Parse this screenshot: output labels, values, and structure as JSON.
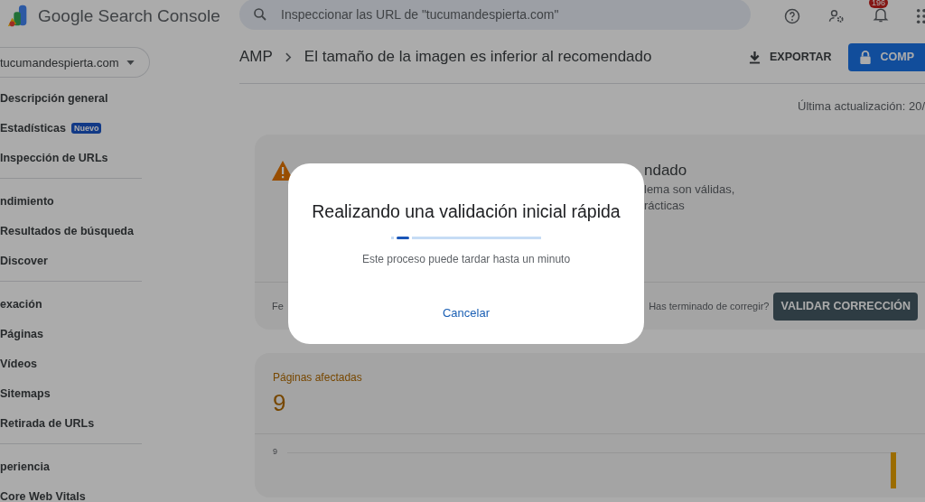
{
  "header": {
    "product": "Google Search Console",
    "search": {
      "placeholder": "Inspeccionar las URL de \"tucumandespierta.com\""
    },
    "notifications_badge": "196"
  },
  "sidebar": {
    "property": "tucumandespierta.com",
    "sections": [
      {
        "items": [
          {
            "label": "Descripción general"
          },
          {
            "label": "Estadísticas",
            "badge": "Nuevo"
          },
          {
            "label": "Inspección de URLs"
          }
        ]
      },
      {
        "heading": "ndimiento",
        "items": [
          {
            "label": "Resultados de búsqueda"
          },
          {
            "label": "Discover"
          }
        ]
      },
      {
        "heading": "exación",
        "items": [
          {
            "label": "Páginas"
          },
          {
            "label": "Vídeos"
          },
          {
            "label": "Sitemaps"
          },
          {
            "label": "Retirada de URLs"
          }
        ]
      },
      {
        "heading": "periencia",
        "items": [
          {
            "label": "Core Web Vitals"
          }
        ]
      }
    ]
  },
  "breadcrumb": [
    "AMP",
    "El tamaño de la imagen es inferior al recomendado"
  ],
  "actions": [
    {
      "label": "EXPORTAR",
      "kind": "export"
    },
    {
      "label": "COMP",
      "kind": "primary"
    }
  ],
  "last_updated": "Última actualización: 20/",
  "issue_card": {
    "title": "ndado",
    "description": [
      "lema son válidas,",
      "rácticas"
    ],
    "footer_left": "Fe",
    "footer_prompt": "Has terminado de corregir?",
    "button": "VALIDAR CORRECCIÓN"
  },
  "affected_card": {
    "label": "Páginas afectadas",
    "value": "9",
    "axis_tick": "9"
  },
  "dialog": {
    "title": "Realizando una validación inicial rápida",
    "message": "Este proceso puede tardar hasta un minuto",
    "button": "Cancelar"
  }
}
